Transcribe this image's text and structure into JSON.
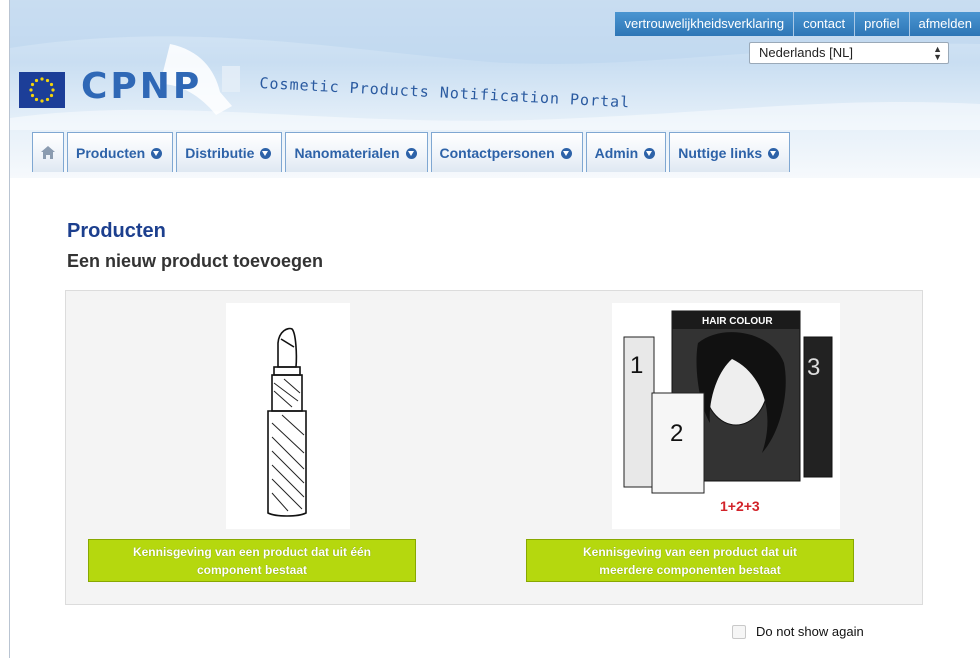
{
  "topnav": [
    "vertrouwelijkheidsverklaring",
    "contact",
    "profiel",
    "afmelden"
  ],
  "language": {
    "selected": "Nederlands [NL]"
  },
  "brand": {
    "logo_text": "CPNP",
    "portal_title": "Cosmetic Products Notification Portal"
  },
  "menu": {
    "home_icon": "home-icon",
    "items": [
      {
        "label": "Producten"
      },
      {
        "label": "Distributie"
      },
      {
        "label": "Nanomaterialen"
      },
      {
        "label": "Contactpersonen"
      },
      {
        "label": "Admin"
      },
      {
        "label": "Nuttige links"
      }
    ]
  },
  "page": {
    "title": "Producten",
    "subtitle": "Een nieuw product toevoegen"
  },
  "choices": [
    {
      "label_line1": "Kennisgeving van een product dat uit één",
      "label_line2": "component bestaat",
      "image": "lipstick-image"
    },
    {
      "label_line1": "Kennisgeving van een product dat uit",
      "label_line2": "meerdere componenten bestaat",
      "image": "hair-colour-kit-image",
      "image_text": "HAIR COLOUR",
      "image_numbers": [
        "1",
        "2",
        "3"
      ],
      "image_caption": "1+2+3"
    }
  ],
  "do_not_show": {
    "label": "Do not show again",
    "checked": false
  },
  "colors": {
    "brand_blue": "#2f68b6",
    "title_blue": "#1c3f8e",
    "button_green": "#b5d80e",
    "topnav_blue": "#2e76b6"
  }
}
